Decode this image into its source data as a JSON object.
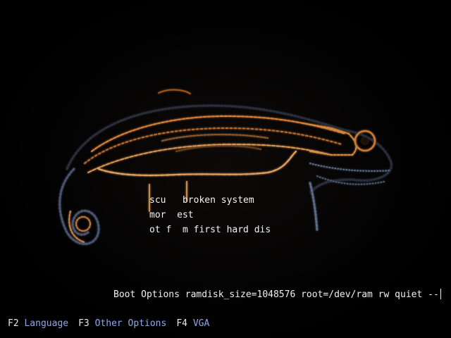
{
  "boot_menu": {
    "items": [
      {
        "label": "scu   broken system"
      },
      {
        "label": "mor  est"
      },
      {
        "label": "ot f  m first hard dis"
      }
    ]
  },
  "boot_options": {
    "label": "Boot Options",
    "value": "ramdisk_size=1048576 root=/dev/ram rw quiet --"
  },
  "function_keys": [
    {
      "key": "F2",
      "label": "Language"
    },
    {
      "key": "F3",
      "label": "Other Options"
    },
    {
      "key": "F4",
      "label": "VGA"
    }
  ],
  "colors": {
    "background": "#000000",
    "text": "#f0f0f0",
    "fkey_label": "#8da9e6",
    "artwork_glow": "#d9823a"
  }
}
